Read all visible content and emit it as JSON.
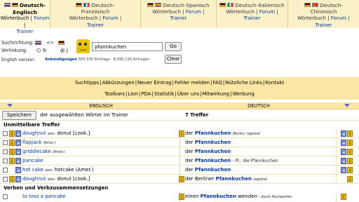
{
  "tabs": [
    {
      "line1": "Deutsch-Englisch",
      "line2": "Wörterbuch",
      "forum": "Forum",
      "trainer": "Trainer",
      "flags": [
        "uk",
        "de"
      ],
      "active": true
    },
    {
      "line1": "Deutsch-",
      "line2": "Französisch",
      "line3": "Wörterbuch",
      "forum": "Forum",
      "trainer": "Trainer",
      "flags": [
        "de",
        "fr"
      ]
    },
    {
      "line1": "Deutsch-Spanisch",
      "line2": "Wörterbuch",
      "forum": "Forum",
      "trainer": "Trainer",
      "flags": [
        "de",
        "es"
      ]
    },
    {
      "line1": "Deutsch-Italienisch",
      "line2": "Wörterbuch",
      "forum": "Forum",
      "trainer": "Trainer",
      "flags": [
        "de",
        "it"
      ]
    },
    {
      "line1": "Deutsch-",
      "line2": "Chinesisch",
      "line3": "Wörterbuch",
      "forum": "Forum",
      "trainer": "Trainer",
      "flags": [
        "de",
        "cn"
      ]
    }
  ],
  "search": {
    "direction_label": "Suchrichtung:",
    "direction_arrow": "<>",
    "linking_label": "Verlinkung:",
    "radio_n": "N",
    "radio_j": "J",
    "radio_selected": "J",
    "query": "pfannkuchen",
    "go_label": "Go",
    "clear_label": "Clear",
    "english_version": "English version",
    "announcements": "Ankündigungen",
    "stats": "565.505 Einträge · 8.095.116 Anfragen"
  },
  "links_row1": [
    "Suchtipps",
    "Abkürzungen",
    "Neuer Eintrag",
    "Fehler melden",
    "FAQ",
    "Nützliche Links",
    "Kontakt"
  ],
  "links_row2": [
    "Toolbars",
    "Lion",
    "PDA",
    "Statistik",
    "Über uns",
    "Mitwirkung",
    "Werbung"
  ],
  "table": {
    "col_left": "ENGLISCH",
    "col_right": "DEUTSCH",
    "save_label": "Speichern",
    "save_text": "der ausgewählten Wörter im Trainer",
    "hits": "7 Treffer",
    "section1": "Unmittelbare Treffer",
    "section2": "Verben und Verbzusammensetzungen",
    "rows": [
      {
        "en": "doughnut",
        "en_extra": "also:",
        "en_extra2": "donut [cook.]",
        "de_pre": "der ",
        "de": "Pfannkuchen",
        "de_note": "(Berlin)",
        "de_note2": "regional"
      },
      {
        "en": "flapjack",
        "en_extra": "(Amer.)",
        "en_extra2": "",
        "de_pre": "der ",
        "de": "Pfannkuchen",
        "de_note": "",
        "de_note2": ""
      },
      {
        "en": "griddlecake",
        "en_extra": "(Amer.)",
        "en_extra2": "",
        "de_pre": "der ",
        "de": "Pfannkuchen",
        "de_note": "",
        "de_note2": ""
      },
      {
        "en": "pancake",
        "en_extra": "",
        "en_extra2": "",
        "de_pre": "der ",
        "de": "Pfannkuchen",
        "de_note": "- Pl.: die Pfannkuchen",
        "de_note2": ""
      },
      {
        "en": "hot cake",
        "en_extra": "also:",
        "en_extra2": "hotcake (Amer.)",
        "de_pre": "der ",
        "de": "Pfannkuchen",
        "de_note": "",
        "de_note2": ""
      },
      {
        "en": "doughnut",
        "en_extra": "also:",
        "en_extra2": "donut [cook.]",
        "de_pre": "der Berliner ",
        "de": "Pfannkuchen",
        "de_note": "regional",
        "de_note2": ""
      }
    ],
    "verb_row": {
      "en": "to toss a pancake",
      "de_pre": "einen ",
      "de": "Pfannkuchen",
      "de_post": " wenden",
      "de_note": "- durch Hochwerfen"
    }
  }
}
